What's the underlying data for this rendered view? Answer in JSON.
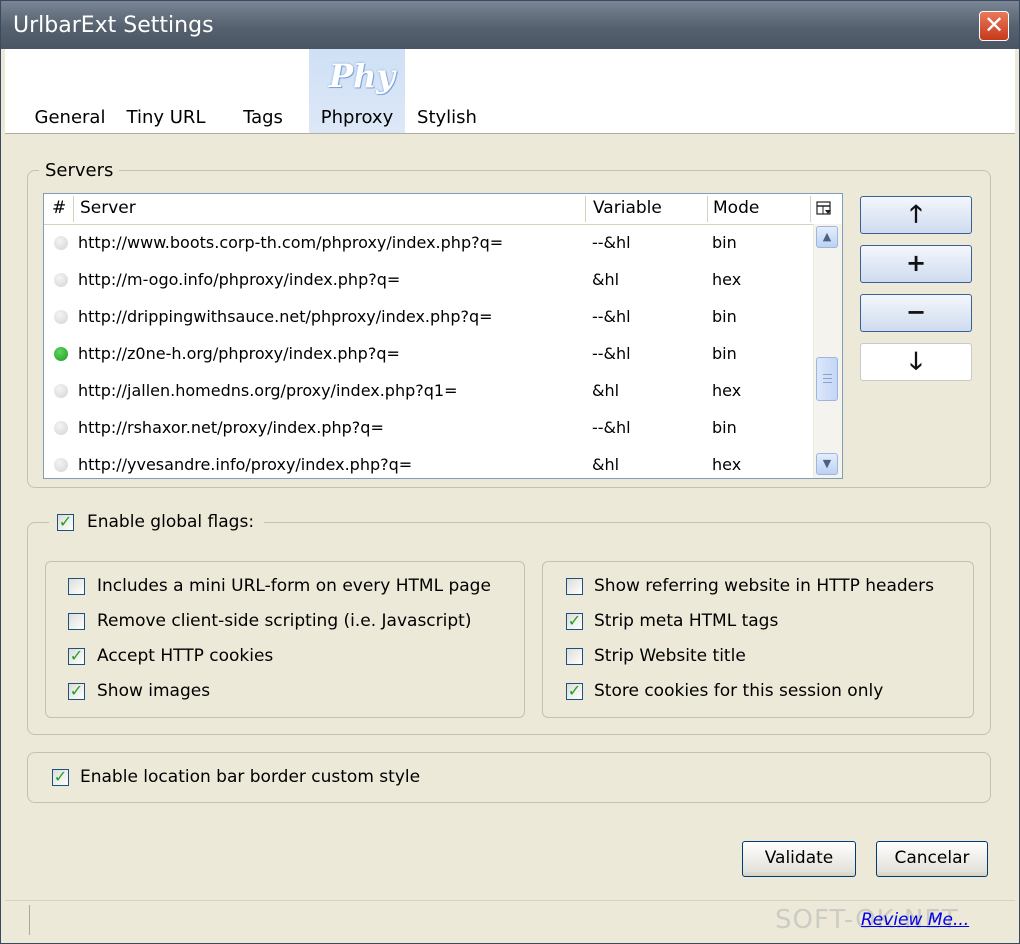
{
  "window": {
    "title": "UrlbarExt Settings",
    "close_glyph": "✕"
  },
  "tabs": [
    {
      "label": "General"
    },
    {
      "label": "Tiny URL"
    },
    {
      "label": "Tags"
    },
    {
      "label": "Phproxy",
      "logo_text": "Phy",
      "active": true
    },
    {
      "label": "Stylish"
    }
  ],
  "servers": {
    "legend": "Servers",
    "columns": {
      "num": "#",
      "server": "Server",
      "variable": "Variable",
      "mode": "Mode"
    },
    "rows": [
      {
        "server": "http://www.boots.corp-th.com/phproxy/index.php?q=",
        "variable": "--&hl",
        "mode": "bin",
        "active": false
      },
      {
        "server": "http://m-ogo.info/phproxy/index.php?q=",
        "variable": "&hl",
        "mode": "hex",
        "active": false
      },
      {
        "server": "http://drippingwithsauce.net/phproxy/index.php?q=",
        "variable": "--&hl",
        "mode": "bin",
        "active": false
      },
      {
        "server": "http://z0ne-h.org/phproxy/index.php?q=",
        "variable": "--&hl",
        "mode": "bin",
        "active": true
      },
      {
        "server": "http://jallen.homedns.org/proxy/index.php?q1=",
        "variable": "&hl",
        "mode": "hex",
        "active": false
      },
      {
        "server": "http://rshaxor.net/proxy/index.php?q=",
        "variable": "--&hl",
        "mode": "bin",
        "active": false
      },
      {
        "server": "http://yvesandre.info/proxy/index.php?q=",
        "variable": "&hl",
        "mode": "hex",
        "active": false
      }
    ],
    "buttons": {
      "move_up": "🡑",
      "add": "+",
      "remove": "−",
      "move_down": "🡓"
    }
  },
  "flags": {
    "enable_label": "Enable global flags:",
    "enabled": true,
    "left": [
      {
        "label": "Includes a mini URL-form on every HTML page",
        "checked": false
      },
      {
        "label": "Remove client-side scripting (i.e. Javascript)",
        "checked": false
      },
      {
        "label": "Accept HTTP cookies",
        "checked": true
      },
      {
        "label": "Show images",
        "checked": true
      }
    ],
    "right": [
      {
        "label": "Show referring website in HTTP headers",
        "checked": false
      },
      {
        "label": "Strip meta HTML tags",
        "checked": true
      },
      {
        "label": "Strip Website title",
        "checked": false
      },
      {
        "label": "Store cookies for this session only",
        "checked": true
      }
    ]
  },
  "location_bar": {
    "label": "Enable location bar border custom style",
    "checked": true
  },
  "footer": {
    "validate": "Validate",
    "cancel": "Cancelar"
  },
  "status": {
    "review_link": "Review Me...",
    "watermark": "SOFT-OK.NET"
  }
}
